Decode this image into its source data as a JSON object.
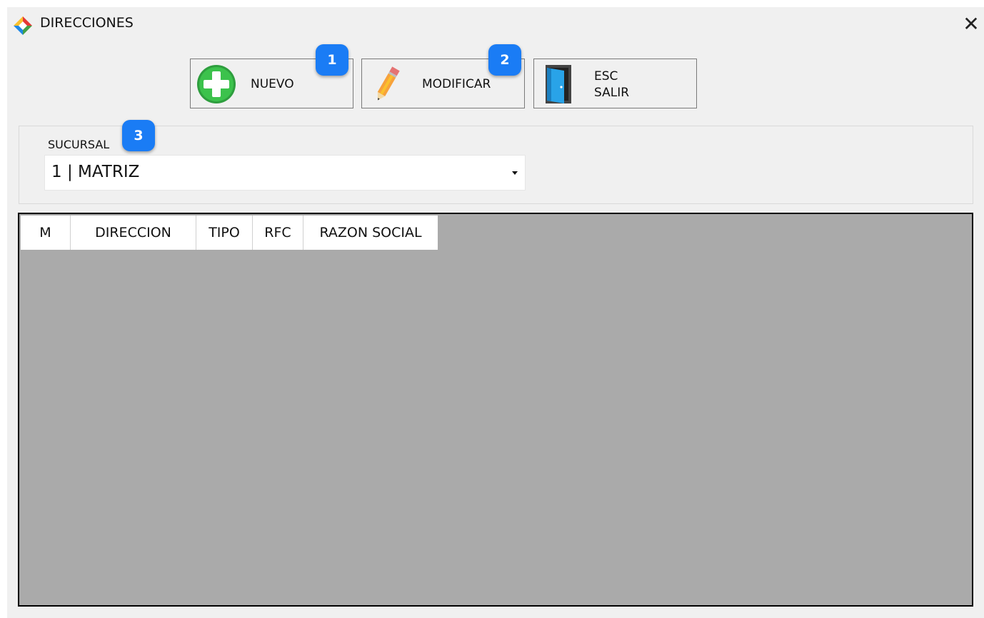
{
  "window": {
    "title": "DIRECCIONES"
  },
  "toolbar": {
    "nuevo_label": "NUEVO",
    "modificar_label": "MODIFICAR",
    "salir_label_line1": "ESC",
    "salir_label_line2": "SALIR"
  },
  "callouts": [
    "1",
    "2",
    "3"
  ],
  "sucursal": {
    "label": "SUCURSAL",
    "value": "1 | MATRIZ"
  },
  "grid": {
    "columns": [
      "M",
      "DIRECCION",
      "TIPO",
      "RFC",
      "RAZON SOCIAL"
    ],
    "rows": []
  },
  "colors": {
    "badge": "#1a7cf5",
    "grid_bg": "#aaaaaa",
    "window_bg": "#f0f0f0"
  }
}
